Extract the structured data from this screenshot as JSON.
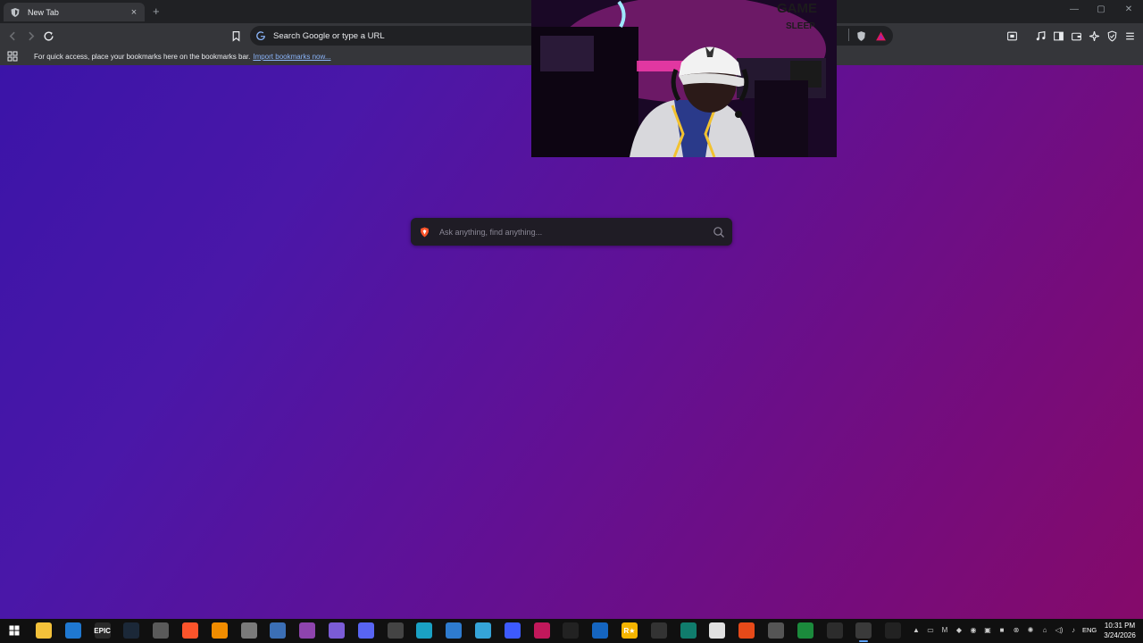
{
  "browser": {
    "tab": {
      "title": "New Tab",
      "close": "×"
    },
    "new_tab_button": "+",
    "window_controls": {
      "minimize": "—",
      "maximize": "▢",
      "close": "✕"
    },
    "omnibox": {
      "placeholder": "Search Google or type a URL"
    },
    "bookmarks_bar": {
      "message": "For quick access, place your bookmarks here on the bookmarks bar.",
      "import_link": "Import bookmarks now..."
    }
  },
  "new_tab_page": {
    "search": {
      "placeholder": "Ask anything, find anything..."
    }
  },
  "webcam_overlay": {
    "sign_top": "GAME",
    "sign_bottom": "SLEEP"
  },
  "taskbar": {
    "apps": [
      {
        "name": "file-explorer",
        "color": "#f3c13a"
      },
      {
        "name": "edge-blue",
        "color": "#1f78d1"
      },
      {
        "name": "epic-games",
        "label": "EPIC",
        "color": "#2a2a2a"
      },
      {
        "name": "steam",
        "color": "#1b2838"
      },
      {
        "name": "generic-app",
        "color": "#5a5a5a"
      },
      {
        "name": "brave",
        "color": "#fb542b"
      },
      {
        "name": "vlc",
        "color": "#f08c00"
      },
      {
        "name": "utility",
        "color": "#7a7a7a"
      },
      {
        "name": "globe",
        "color": "#3b6fb5"
      },
      {
        "name": "color-bars",
        "color": "#8e44ad"
      },
      {
        "name": "chat",
        "color": "#7b5cd6"
      },
      {
        "name": "game-controller",
        "color": "#5865f2"
      },
      {
        "name": "steelseries",
        "color": "#444444"
      },
      {
        "name": "folder-teal",
        "color": "#1aa1c4"
      },
      {
        "name": "diamond",
        "color": "#2e7bcf"
      },
      {
        "name": "tool",
        "color": "#35a4d9"
      },
      {
        "name": "monitor",
        "color": "#3d5afe"
      },
      {
        "name": "rocket",
        "color": "#c2185b"
      },
      {
        "name": "dark-app",
        "color": "#222222"
      },
      {
        "name": "blue-square",
        "color": "#1565c0"
      },
      {
        "name": "rockstar",
        "label": "R★",
        "color": "#f4b400"
      },
      {
        "name": "media",
        "color": "#333333"
      },
      {
        "name": "terminal",
        "color": "#107c6c"
      },
      {
        "name": "white-square",
        "color": "#e0e0e0"
      },
      {
        "name": "ea-app",
        "color": "#e64a19"
      },
      {
        "name": "photo-app",
        "color": "#555555"
      },
      {
        "name": "sheets-app",
        "color": "#1b8a3c"
      },
      {
        "name": "dark-square",
        "color": "#2c2c2c"
      },
      {
        "name": "obs",
        "color": "#3a3a3a",
        "active": true
      },
      {
        "name": "steelseries-gg",
        "color": "#222222"
      }
    ],
    "language": "ENG",
    "time": "10:31 PM",
    "date": "3/24/2026"
  }
}
